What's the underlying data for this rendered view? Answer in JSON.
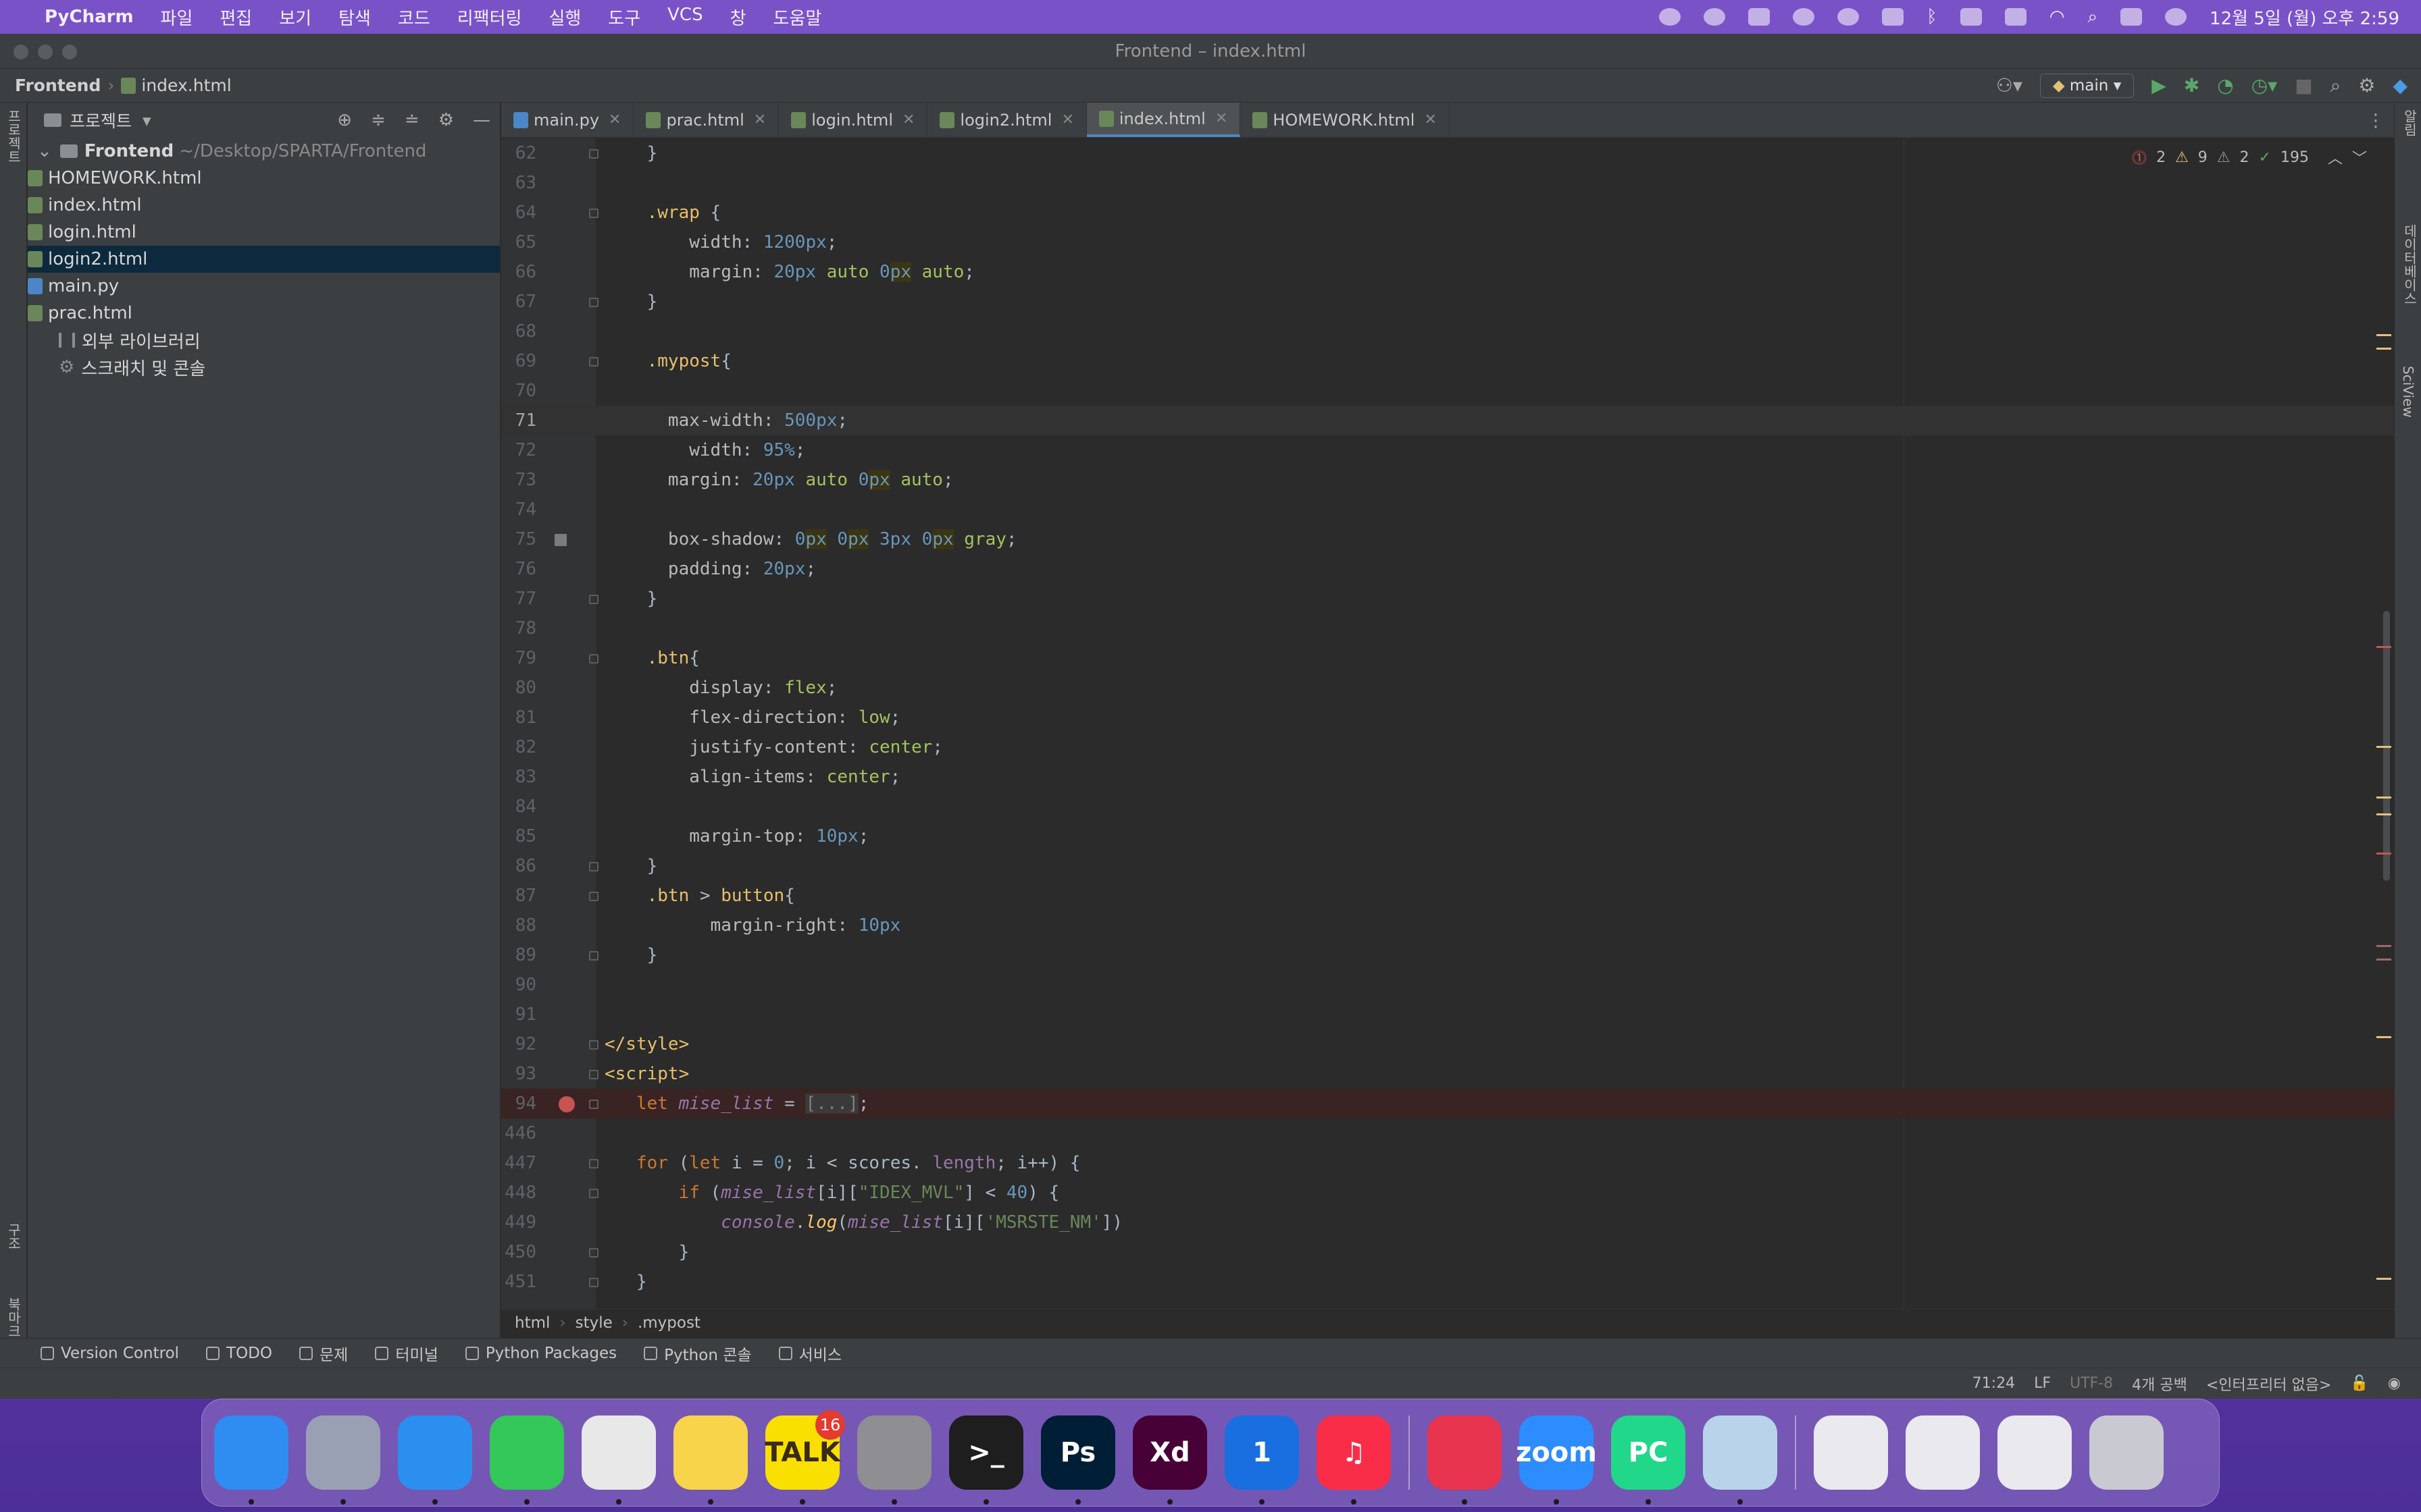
{
  "menubar": {
    "app": "PyCharm",
    "items": [
      "파일",
      "편집",
      "보기",
      "탐색",
      "코드",
      "리팩터링",
      "실행",
      "도구",
      "VCS",
      "창",
      "도움말"
    ],
    "clock": "12월 5일 (월) 오후 2:59"
  },
  "window": {
    "title": "Frontend – index.html"
  },
  "navbar": {
    "project": "Frontend",
    "file": "index.html",
    "branch": "main"
  },
  "project_panel": {
    "title": "프로젝트",
    "root": "Frontend",
    "root_path": "~/Desktop/SPARTA/Frontend",
    "files": [
      "HOMEWORK.html",
      "index.html",
      "login.html",
      "login2.html",
      "main.py",
      "prac.html"
    ],
    "selected_file": "login2.html",
    "external_libs": "외부 라이브러리",
    "scratches": "스크래치 및 콘솔"
  },
  "tabs": [
    {
      "label": "main.py",
      "type": "py"
    },
    {
      "label": "prac.html",
      "type": "html"
    },
    {
      "label": "login.html",
      "type": "html"
    },
    {
      "label": "login2.html",
      "type": "html"
    },
    {
      "label": "index.html",
      "type": "html",
      "active": true
    },
    {
      "label": "HOMEWORK.html",
      "type": "html"
    }
  ],
  "inspections": {
    "errors": "2",
    "warnings": "9",
    "weak_warnings": "2",
    "ok": "195"
  },
  "code_lines": [
    {
      "n": "62",
      "html": "    }"
    },
    {
      "n": "63",
      "html": ""
    },
    {
      "n": "64",
      "html": "    <span class='sel'>.wrap</span> {"
    },
    {
      "n": "65",
      "html": "        <span class='prop'>width</span>: <span class='num'>1200px</span>;"
    },
    {
      "n": "66",
      "html": "        <span class='prop'>margin</span>: <span class='num'>20px</span> <span class='val'>auto</span> <span class='num'>0<span class='hl'>px</span></span> <span class='val'>auto</span>;"
    },
    {
      "n": "67",
      "html": "    }"
    },
    {
      "n": "68",
      "html": ""
    },
    {
      "n": "69",
      "html": "    <span class='sel'>.mypost</span>{"
    },
    {
      "n": "70",
      "html": ""
    },
    {
      "n": "71",
      "html": "      <span class='prop'>max-width</span>: <span class='num'>500px</span>;"
    },
    {
      "n": "72",
      "html": "        <span class='prop'>width</span>: <span class='num'>95%</span>;"
    },
    {
      "n": "73",
      "html": "      <span class='prop'>margin</span>: <span class='num'>20px</span> <span class='val'>auto</span> <span class='num'>0<span class='hl'>px</span></span> <span class='val'>auto</span>;"
    },
    {
      "n": "74",
      "html": ""
    },
    {
      "n": "75",
      "html": "      <span class='prop'>box-shadow</span>: <span class='num'>0<span class='hl'>px</span></span> <span class='num'>0<span class='hl'>px</span></span> <span class='num'>3px</span> <span class='num'>0<span class='hl'>px</span></span> <span class='val'>gray</span>;"
    },
    {
      "n": "76",
      "html": "      <span class='prop'>padding</span>: <span class='num'>20px</span>;"
    },
    {
      "n": "77",
      "html": "    }"
    },
    {
      "n": "78",
      "html": ""
    },
    {
      "n": "79",
      "html": "    <span class='sel'>.btn</span>{"
    },
    {
      "n": "80",
      "html": "        <span class='prop'>display</span>: <span class='val'>flex</span>;"
    },
    {
      "n": "81",
      "html": "        <span class='prop'>flex-direction</span>: <span class='val'>low</span>;"
    },
    {
      "n": "82",
      "html": "        <span class='prop'>justify-content</span>: <span class='val'>center</span>;"
    },
    {
      "n": "83",
      "html": "        <span class='prop'>align-items</span>: <span class='val'>center</span>;"
    },
    {
      "n": "84",
      "html": ""
    },
    {
      "n": "85",
      "html": "        <span class='prop'>margin-top</span>: <span class='num'>10px</span>;"
    },
    {
      "n": "86",
      "html": "    }"
    },
    {
      "n": "87",
      "html": "    <span class='sel'>.btn</span> &gt; <span class='sel'>button</span>{"
    },
    {
      "n": "88",
      "html": "          <span class='prop'>margin-right</span>: <span class='num'>10px</span>"
    },
    {
      "n": "89",
      "html": "    }"
    },
    {
      "n": "90",
      "html": ""
    },
    {
      "n": "91",
      "html": ""
    },
    {
      "n": "92",
      "html": "<span class='tag'>&lt;/style&gt;</span>"
    },
    {
      "n": "93",
      "html": "<span class='tag'>&lt;script&gt;</span>"
    },
    {
      "n": "94",
      "html": "   <span class='kw'>let</span> <span class='var'>mise_list</span> = <span style='color:#808080;background:#3a3a3a'>[...]</span>;"
    },
    {
      "n": "446",
      "html": ""
    },
    {
      "n": "447",
      "html": "   <span class='kw'>for</span> (<span class='kw'>let</span> i = <span class='num'>0</span>; i &lt; scores. <span class='var' style='font-style:normal'>length</span>; i++) {"
    },
    {
      "n": "448",
      "html": "       <span class='kw'>if</span> (<span class='var'>mise_list</span>[i][<span class='str'>\"IDEX_MVL\"</span>] &lt; <span class='num'>40</span>) {"
    },
    {
      "n": "449",
      "html": "           <span class='var'>console</span>.<span class='fn'>log</span>(<span class='var'>mise_list</span>[i][<span class='str'>'MSRSTE_NM'</span>])"
    },
    {
      "n": "450",
      "html": "       }"
    },
    {
      "n": "451",
      "html": "   }"
    }
  ],
  "current_line": "71",
  "breakpoint_line": "94",
  "bookmark_line": "75",
  "breadcrumb": [
    "html",
    "style",
    ".mypost"
  ],
  "bottom_tools": [
    "Version Control",
    "TODO",
    "문제",
    "터미널",
    "Python Packages",
    "Python 콘솔",
    "서비스"
  ],
  "status": {
    "position": "71:24",
    "line_sep": "LF",
    "encoding": "UTF-8",
    "indent": "4개 공백",
    "interpreter": "<인터프리터 없음>"
  },
  "left_strip": {
    "project": "프로젝트",
    "structure": "구조",
    "bookmarks": "북마크"
  },
  "right_strip": {
    "notifications": "알림",
    "database": "데이터베이스",
    "sciview": "SciView"
  },
  "dock": {
    "talk_badge": "16",
    "apps": [
      {
        "name": "finder",
        "color": "#2f8cf0",
        "label": ""
      },
      {
        "name": "launchpad",
        "color": "#9aa0b4",
        "label": ""
      },
      {
        "name": "safari",
        "color": "#2b8ff0",
        "label": ""
      },
      {
        "name": "messages",
        "color": "#34c759",
        "label": ""
      },
      {
        "name": "chrome",
        "color": "#e8e8e8",
        "label": ""
      },
      {
        "name": "notes",
        "color": "#f7d44a",
        "label": ""
      },
      {
        "name": "kakaotalk",
        "color": "#f9e000",
        "label": "TALK"
      },
      {
        "name": "system-settings",
        "color": "#8e8e93",
        "label": ""
      },
      {
        "name": "terminal",
        "color": "#1e1e1e",
        "label": ">_"
      },
      {
        "name": "photoshop",
        "color": "#001e36",
        "label": "Ps"
      },
      {
        "name": "xd",
        "color": "#470137",
        "label": "Xd"
      },
      {
        "name": "1password",
        "color": "#1a6fe0",
        "label": "1"
      },
      {
        "name": "music",
        "color": "#fa2d48",
        "label": "♫"
      },
      {
        "name": "creative-cloud",
        "color": "#e8344e",
        "label": ""
      },
      {
        "name": "zoom",
        "color": "#2d8cff",
        "label": "zoom"
      },
      {
        "name": "pycharm",
        "color": "#21d789",
        "label": "PC"
      },
      {
        "name": "preview",
        "color": "#b8d3ea",
        "label": ""
      }
    ]
  }
}
